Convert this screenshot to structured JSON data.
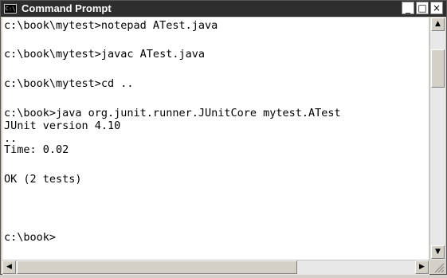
{
  "window": {
    "title": "Command Prompt",
    "icon": "cmd-icon",
    "icon_text": "C:\\",
    "controls": {
      "minimize": "_",
      "maximize": "□",
      "close": "×"
    }
  },
  "console": {
    "lines": [
      "c:\\book\\mytest>notepad ATest.java",
      "",
      "c:\\book\\mytest>javac ATest.java",
      "",
      "c:\\book\\mytest>cd ..",
      "",
      "c:\\book>java org.junit.runner.JUnitCore mytest.ATest",
      "JUnit version 4.10",
      "..",
      "Time: 0.02",
      "",
      "OK (2 tests)",
      "",
      "",
      "c:\\book>"
    ]
  },
  "scrollbars": {
    "up_arrow": "▲",
    "down_arrow": "▼",
    "left_arrow": "◀",
    "right_arrow": "▶"
  }
}
